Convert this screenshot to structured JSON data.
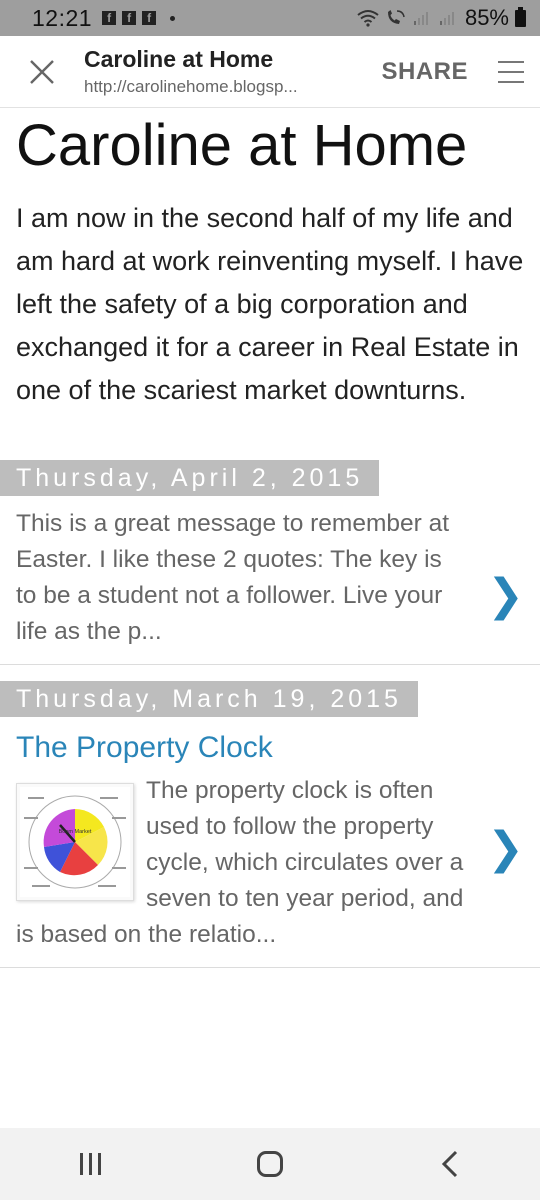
{
  "status_bar": {
    "time": "12:21",
    "notification_icons": [
      "facebook-icon",
      "facebook-icon",
      "facebook-icon"
    ],
    "battery": "85%"
  },
  "toolbar": {
    "title": "Caroline at Home",
    "url": "http://carolinehome.blogsp...",
    "share_label": "SHARE"
  },
  "blog": {
    "title": "Caroline at Home",
    "description": "I am now in the second half of my life and am hard at work reinventing myself. I have left the safety of a big corporation and exchanged it for a career in Real Estate in one of the scariest market downturns."
  },
  "posts": [
    {
      "date": "Thursday, April 2, 2015",
      "title": "",
      "snippet": "This is a great message to remember at Easter. I like these 2 quotes: The key is to be a student not a follower. Live your life as the p..."
    },
    {
      "date": "Thursday, March 19, 2015",
      "title": "The Property Clock",
      "snippet": "The property clock is often used to follow the property cycle, which circulates over a seven to ten year period, and is based on the relatio...",
      "thumbnail_center_label": "Boom Market"
    }
  ],
  "colors": {
    "link": "#2a85b8",
    "date_header_bg": "#bdbdbd",
    "status_bar_bg": "#9e9e9e"
  }
}
